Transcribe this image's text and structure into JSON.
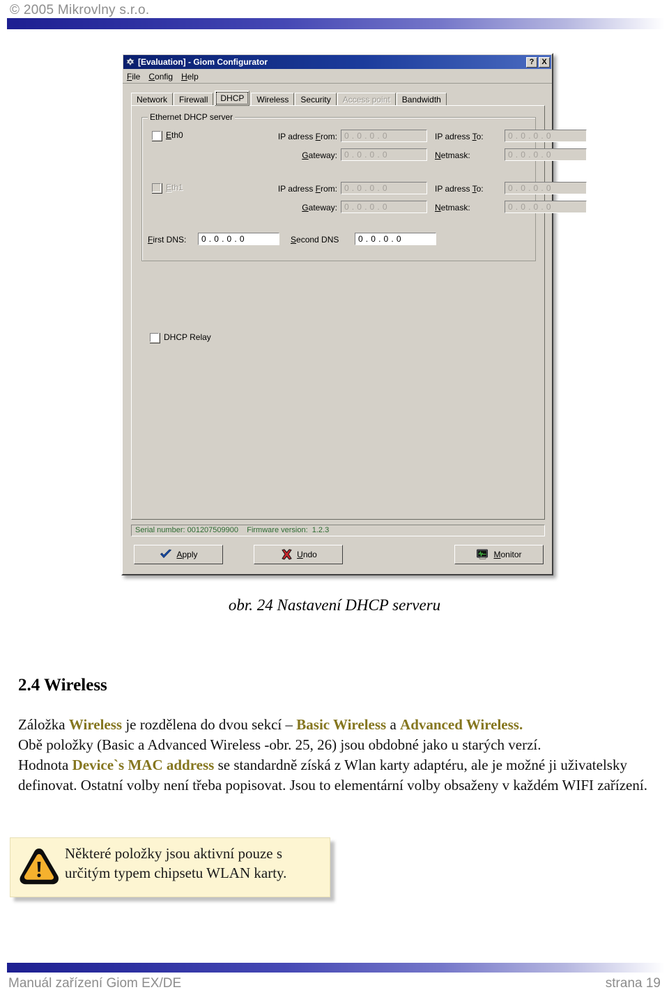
{
  "document": {
    "header_copyright": "© 2005 Mikrovlny  s.r.o.",
    "footer_left": "Manuál zařízení Giom EX/DE",
    "footer_right": "strana 19",
    "figure_caption": "obr. 24 Nastavení DHCP serveru",
    "section_heading": "2.4 Wireless"
  },
  "colors": {
    "highlight": "#85761f",
    "titlebar_start": "#0a1f6e",
    "titlebar_end": "#4a6bc0",
    "window_face": "#d4d0c8",
    "status_text": "#2e6b33",
    "callout_bg": "#fdf5d2",
    "rule_bar": "#1d1f91"
  },
  "screenshot": {
    "window_title": "[Evaluation] - Giom Configurator",
    "title_icon": "app-logo-icon",
    "titlebar_buttons": [
      {
        "name": "help-button",
        "label": "?"
      },
      {
        "name": "close-button",
        "label": "X"
      }
    ],
    "menu": [
      {
        "name": "menu-file",
        "label": "File",
        "accel": "F"
      },
      {
        "name": "menu-config",
        "label": "Config",
        "accel": "C"
      },
      {
        "name": "menu-help",
        "label": "Help",
        "accel": "H"
      }
    ],
    "tabs": [
      {
        "label": "Network",
        "selected": false,
        "disabled": false
      },
      {
        "label": "Firewall",
        "selected": false,
        "disabled": false
      },
      {
        "label": "DHCP",
        "selected": true,
        "disabled": false
      },
      {
        "label": "Wireless",
        "selected": false,
        "disabled": false
      },
      {
        "label": "Security",
        "selected": false,
        "disabled": false
      },
      {
        "label": "Access point",
        "selected": false,
        "disabled": true
      },
      {
        "label": "Bandwidth",
        "selected": false,
        "disabled": false
      }
    ],
    "group": {
      "title": "Ethernet DHCP server",
      "eth0": {
        "checkbox_label": "Eth0",
        "checkbox_accel": "E",
        "checked": false,
        "disabled": false,
        "fields": {
          "ip_from_label": "IP adress From:",
          "ip_from_value": "0 . 0 . 0 . 0",
          "ip_to_label": "IP adress To:",
          "ip_to_value": "0 . 0 . 0 . 0",
          "gateway_label": "Gateway:",
          "gateway_value": "0 . 0 . 0 . 0",
          "netmask_label": "Netmask:",
          "netmask_value": "0 . 0 . 0 . 0"
        }
      },
      "eth1": {
        "checkbox_label": "Eth1",
        "checkbox_accel": "E",
        "checked": false,
        "disabled": true,
        "fields": {
          "ip_from_label": "IP adress From:",
          "ip_from_value": "0 . 0 . 0 . 0",
          "ip_to_label": "IP adress To:",
          "ip_to_value": "0 . 0 . 0 . 0",
          "gateway_label": "Gateway:",
          "gateway_value": "0 . 0 . 0 . 0",
          "netmask_label": "Netmask:",
          "netmask_value": "0 . 0 . 0 . 0"
        }
      },
      "dns": {
        "first_label": "First DNS:",
        "first_value": "0 . 0 . 0 . 0",
        "second_label": "Second DNS",
        "second_value": "0 . 0 . 0 . 0"
      }
    },
    "dhcp_relay": {
      "label": "DHCP Relay",
      "checked": false
    },
    "status_bar": "Serial number: 001207509900    Firmware version:  1.2.3",
    "buttons": [
      {
        "name": "apply-button",
        "label": "Apply",
        "accel": "A",
        "icon": "blue-check-icon"
      },
      {
        "name": "undo-button",
        "label": "Undo",
        "accel": "U",
        "icon": "red-x-icon"
      },
      {
        "name": "monitor-button",
        "label": "Monitor",
        "accel": "M",
        "icon": "monitor-icon"
      }
    ]
  },
  "body_text": {
    "p1_a": "Záložka ",
    "p1_hl1": "Wireless",
    "p1_b": "  je rozdělena do dvou sekcí – ",
    "p1_hl2": "Basic Wireless",
    "p1_c": " a ",
    "p1_hl3": "Advanced Wireless.",
    "p2": "Obě položky (Basic a Advanced Wireless -obr. 25, 26) jsou obdobné jako u starých verzí.",
    "p3_a": "Hodnota ",
    "p3_hl": "Device`s MAC address",
    "p3_b": "  se standardně získá  z  Wlan karty adaptéru, ale je možné ji uživatelsky definovat. Ostatní volby není třeba popisovat. Jsou to elementární volby obsaženy v každém WIFI zařízení."
  },
  "callout": {
    "icon": "warning-triangle-icon",
    "text": "Některé položky jsou aktivní pouze s určitým typem chipsetu WLAN karty."
  }
}
